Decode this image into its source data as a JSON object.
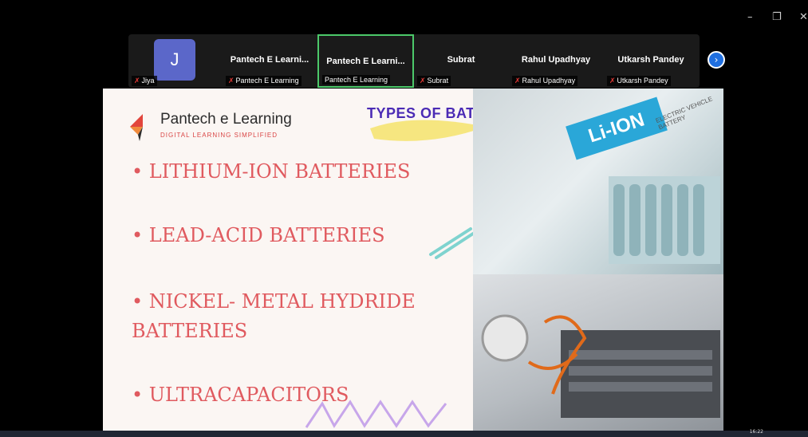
{
  "window": {
    "controls": {
      "minimize": "–",
      "restore": "❐",
      "close": "✕"
    }
  },
  "participants": [
    {
      "name": "",
      "label": "Jiya",
      "avatar_initial": "J",
      "muted": true
    },
    {
      "name": "Pantech E Learni...",
      "label": "Pantech E Learning",
      "muted": true
    },
    {
      "name": "Pantech E Learni...",
      "label": "Pantech E Learning",
      "muted": false,
      "active": true
    },
    {
      "name": "Subrat",
      "label": "Subrat",
      "muted": true
    },
    {
      "name": "Rahul Upadhyay",
      "label": "Rahul Upadhyay",
      "muted": true
    },
    {
      "name": "Utkarsh Pandey",
      "label": "Utkarsh Pandey",
      "muted": true
    }
  ],
  "slide": {
    "logo_name": "Pantech e Learning",
    "logo_tagline": "DIGITAL LEARNING SIMPLIFIED",
    "title": "TYPES OF BATTERIES USED IN EV",
    "bullets": [
      "• LITHIUM-ION BATTERIES",
      "• LEAD-ACID BATTERIES",
      "• NICKEL- METAL HYDRIDE",
      "BATTERIES",
      "• ULTRACAPACITORS"
    ],
    "photo_label": "Li-ION",
    "photo_sublabel": "ELECTRIC VEHICLE BATTERY"
  },
  "taskbar": {
    "clock": "16:22"
  },
  "colors": {
    "accent": "#4b2bb5",
    "bullet": "#e05a5f",
    "active_border": "#4cc96a",
    "avatar": "#5b67c9"
  }
}
